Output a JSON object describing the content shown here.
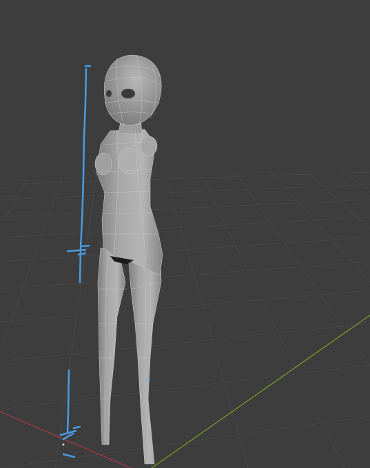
{
  "app": "3D viewport",
  "scene": {
    "object": "character-body-mesh",
    "shading": "solid-wireframe-overlay",
    "rig_helpers": [
      "bone-helper-upper",
      "bone-helper-lower"
    ]
  },
  "colors": {
    "background": "#3d3d3d",
    "grid": "#4a4a4a",
    "x_axis": "#b03a46",
    "y_axis": "#7aa32a",
    "mesh": "#9a9a9a",
    "mesh_wire": "#c9c9c9",
    "helper": "#4b9ce0"
  }
}
